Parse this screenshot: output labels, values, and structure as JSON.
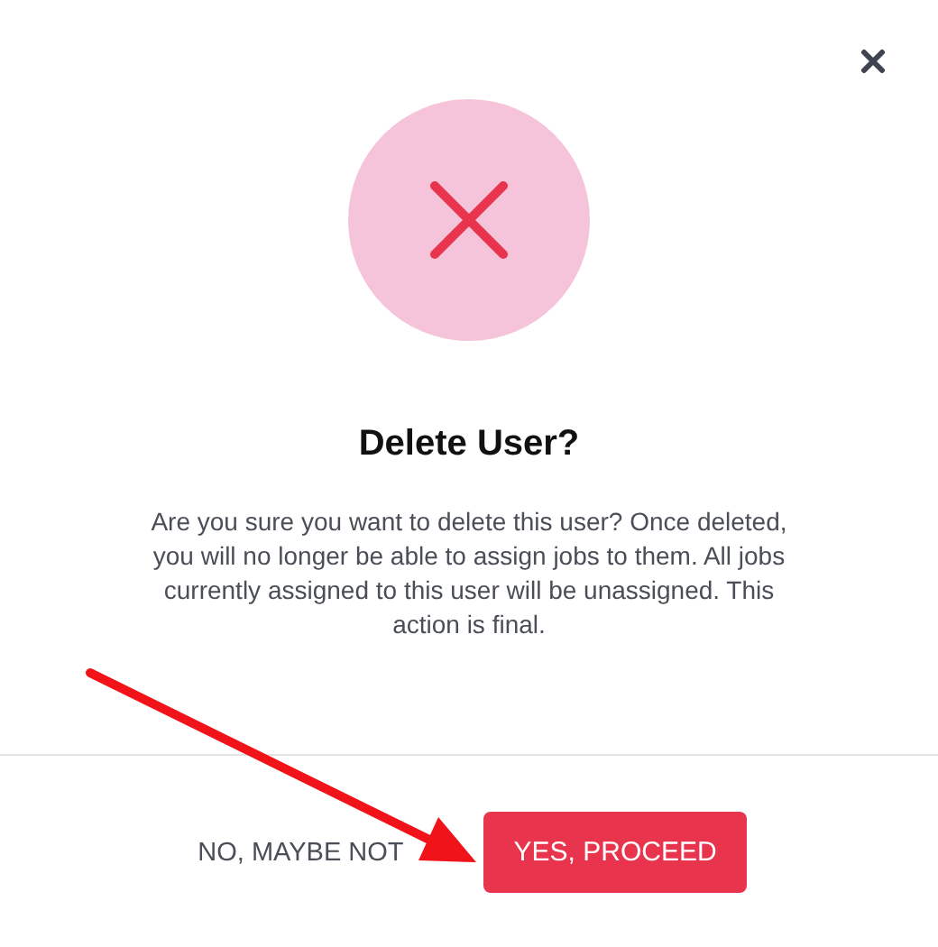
{
  "dialog": {
    "title": "Delete User?",
    "message": "Are you sure you want to delete this user? Once deleted, you will no longer be able to assign jobs to them. All jobs currently assigned to this user will be unassigned. This action is final.",
    "buttons": [
      {
        "label": "NO, MAYBE NOT",
        "kind": "secondary"
      },
      {
        "label": "YES, PROCEED",
        "kind": "primary"
      }
    ]
  }
}
